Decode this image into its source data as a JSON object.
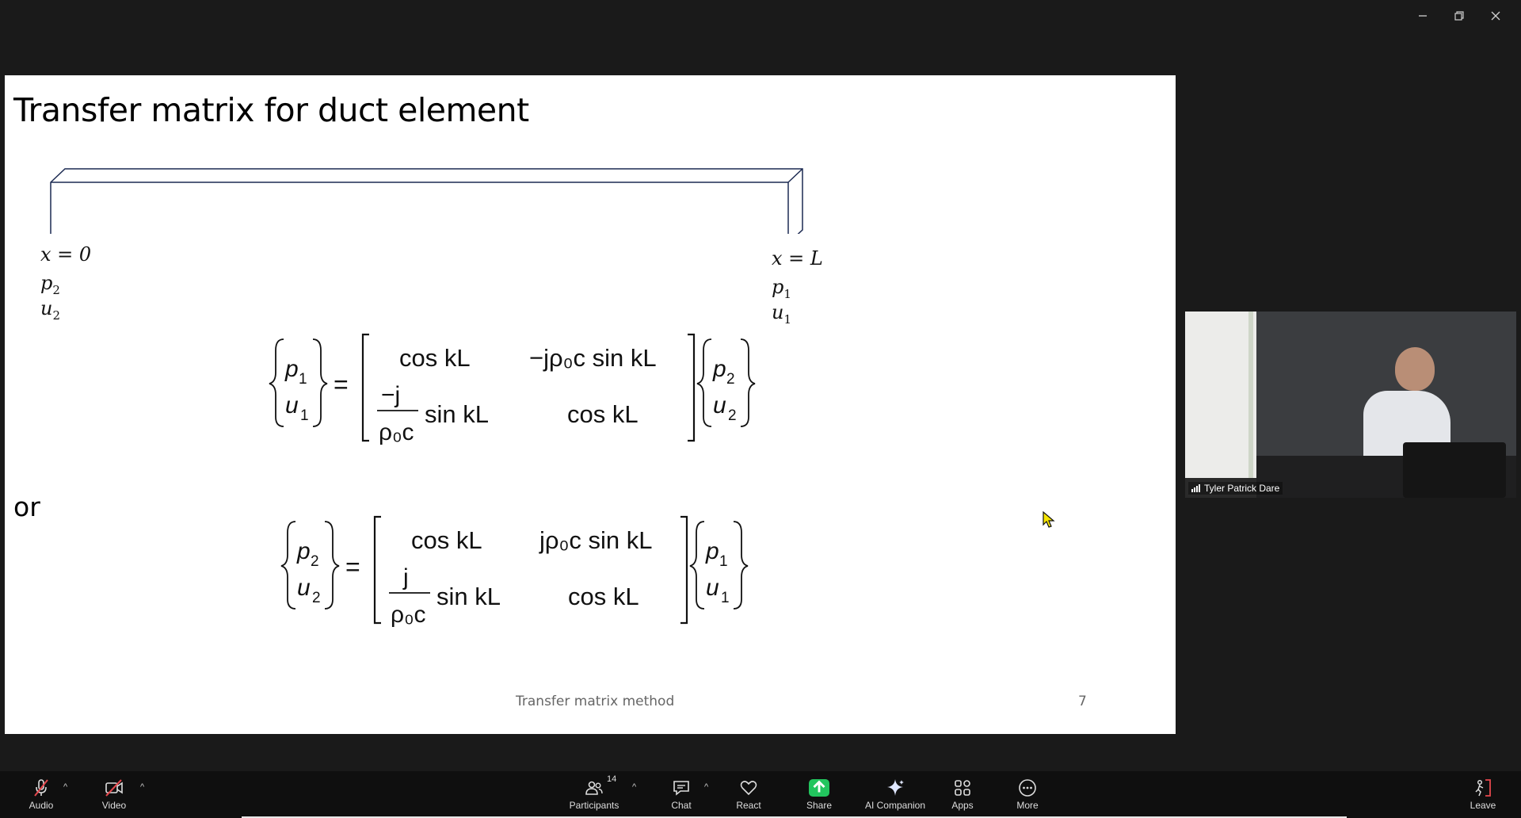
{
  "window_controls": {
    "minimize": "—",
    "restore": "❐",
    "close": "✕"
  },
  "slide": {
    "title": "Transfer matrix for duct element",
    "left_labels": {
      "x": "x = 0",
      "p": "p",
      "p_sub": "2",
      "u": "u",
      "u_sub": "2"
    },
    "right_labels": {
      "x": "x = L",
      "p": "p",
      "p_sub": "1",
      "u": "u",
      "u_sub": "1"
    },
    "or": "or",
    "footer": "Transfer matrix method",
    "page_number": "7",
    "eq1": {
      "lhs": [
        "p",
        "1",
        "u",
        "1"
      ],
      "m11": "cos kL",
      "m12": "−jρ₀c sin kL",
      "m21_num": "−j",
      "m21_den": "ρ₀c",
      "m21_tail": "sin kL",
      "m22": "cos kL",
      "rhs": [
        "p",
        "2",
        "u",
        "2"
      ]
    },
    "eq2": {
      "lhs": [
        "p",
        "2",
        "u",
        "2"
      ],
      "m11": "cos kL",
      "m12": "jρ₀c sin kL",
      "m21_num": "j",
      "m21_den": "ρ₀c",
      "m21_tail": "sin kL",
      "m22": "cos kL",
      "rhs": [
        "p",
        "1",
        "u",
        "1"
      ]
    }
  },
  "video": {
    "participant_name": "Tyler Patrick Dare"
  },
  "toolbar": {
    "audio": "Audio",
    "video": "Video",
    "participants": "Participants",
    "participants_count": "14",
    "chat": "Chat",
    "react": "React",
    "share": "Share",
    "ai_companion": "AI Companion",
    "apps": "Apps",
    "more": "More",
    "leave": "Leave"
  }
}
